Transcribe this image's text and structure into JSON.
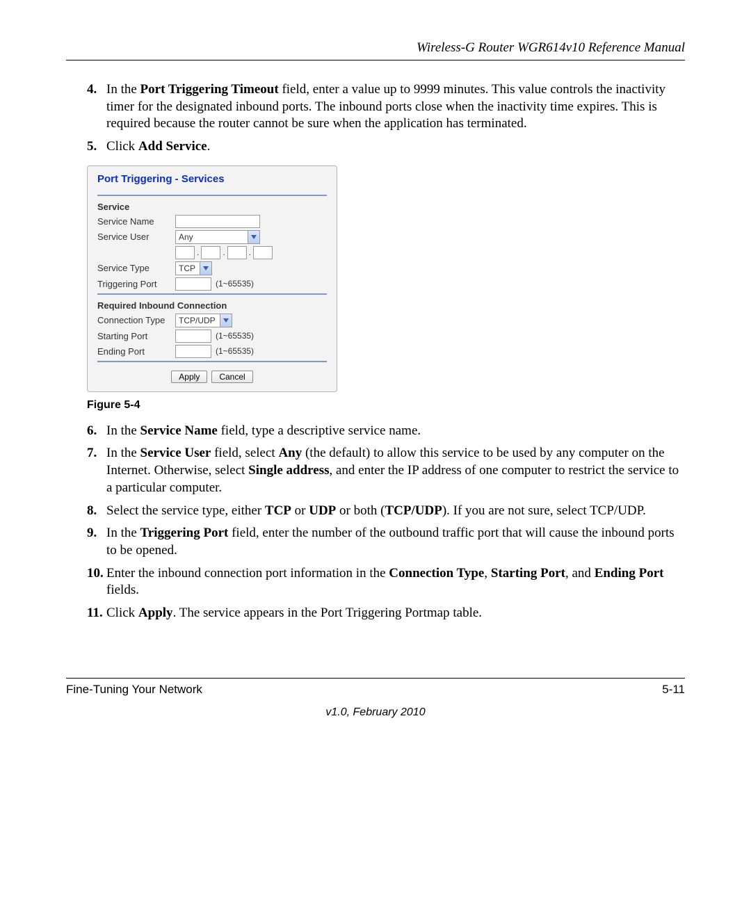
{
  "header": {
    "title": "Wireless-G Router WGR614v10 Reference Manual"
  },
  "steps": {
    "s4": {
      "num": "4.",
      "pre": "In the ",
      "b1": "Port Triggering Timeout",
      "post": " field, enter a value up to 9999 minutes. This value controls the inactivity timer for the designated inbound ports. The inbound ports close when the inactivity time expires. This is required because the router cannot be sure when the application has terminated."
    },
    "s5": {
      "num": "5.",
      "pre": "Click ",
      "b1": "Add Service",
      "post": "."
    },
    "s6": {
      "num": "6.",
      "pre": "In the ",
      "b1": "Service Name",
      "post": " field, type a descriptive service name."
    },
    "s7": {
      "num": "7.",
      "t1": "In the ",
      "b1": "Service User",
      "t2": " field, select ",
      "b2": "Any",
      "t3": " (the default) to allow this service to be used by any computer on the Internet. Otherwise, select ",
      "b3": "Single address",
      "t4": ", and enter the IP address of one computer to restrict the service to a particular computer."
    },
    "s8": {
      "num": "8.",
      "t1": "Select the service type, either ",
      "b1": "TCP",
      "t2": " or ",
      "b2": "UDP",
      "t3": " or both (",
      "b3": "TCP/UDP",
      "t4": "). If you are not sure, select TCP/UDP."
    },
    "s9": {
      "num": "9.",
      "t1": "In the ",
      "b1": "Triggering Port",
      "t2": " field, enter the number of the outbound traffic port that will cause the inbound ports to be opened."
    },
    "s10": {
      "num": "10.",
      "t1": "Enter the inbound connection port information in the ",
      "b1": "Connection Type",
      "t2": ", ",
      "b2": "Starting Port",
      "t3": ", and ",
      "b3": "Ending Port",
      "t4": " fields."
    },
    "s11": {
      "num": "11.",
      "t1": "Click ",
      "b1": "Apply",
      "t2": ". The service appears in the Port Triggering Portmap table."
    }
  },
  "figure": {
    "caption": "Figure 5-4",
    "title": "Port Triggering - Services",
    "section1": "Service",
    "service_name_label": "Service Name",
    "service_user_label": "Service User",
    "service_user_value": "Any",
    "service_type_label": "Service Type",
    "service_type_value": "TCP",
    "triggering_port_label": "Triggering Port",
    "range_hint": "(1~65535)",
    "section2": "Required Inbound Connection",
    "connection_type_label": "Connection Type",
    "connection_type_value": "TCP/UDP",
    "starting_port_label": "Starting Port",
    "ending_port_label": "Ending Port",
    "apply_btn": "Apply",
    "cancel_btn": "Cancel"
  },
  "footer": {
    "left": "Fine-Tuning Your Network",
    "right": "5-11",
    "version": "v1.0, February 2010"
  }
}
